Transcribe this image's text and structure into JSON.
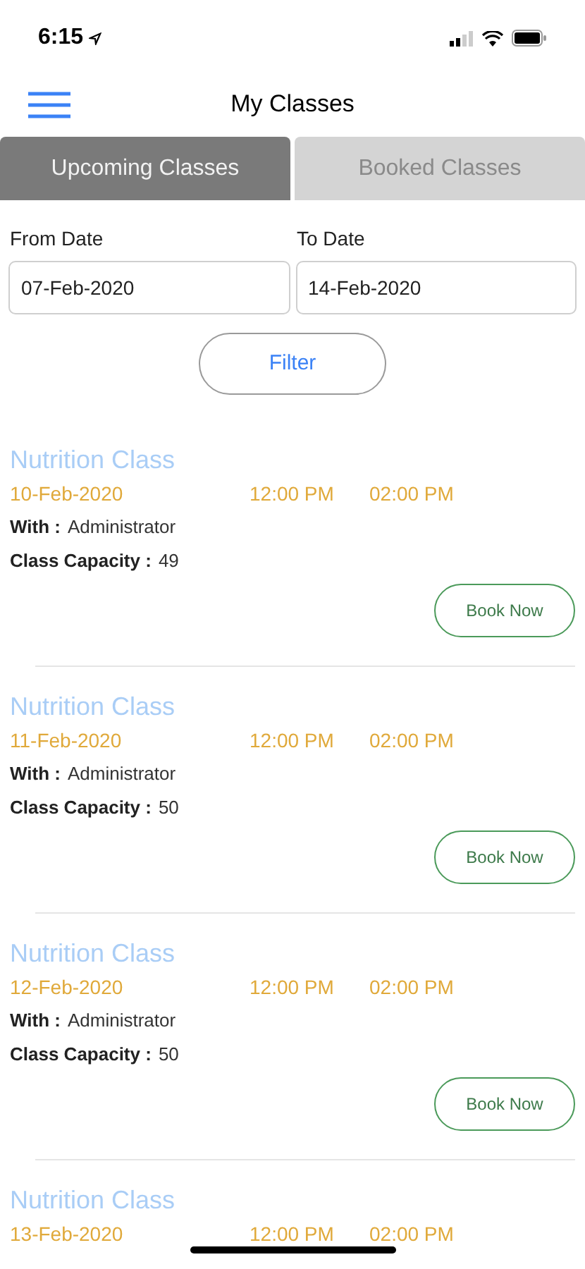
{
  "status_bar": {
    "time": "6:15"
  },
  "nav": {
    "title": "My Classes"
  },
  "tabs": [
    {
      "label": "Upcoming Classes",
      "selected": true
    },
    {
      "label": "Booked Classes",
      "selected": false
    }
  ],
  "filters": [
    {
      "label": "From Date",
      "value": "07-Feb-2020"
    },
    {
      "label": "To Date",
      "value": "14-Feb-2020"
    }
  ],
  "filter_button": "Filter",
  "classes": [
    {
      "title": "Nutrition Class",
      "date": "10-Feb-2020",
      "start": "12:00 PM",
      "end": "02:00 PM",
      "with_label": "With :",
      "with_value": "Administrator",
      "capacity_label": "Class Capacity :",
      "capacity_value": "49",
      "button": "Book Now"
    },
    {
      "title": "Nutrition Class",
      "date": "11-Feb-2020",
      "start": "12:00 PM",
      "end": "02:00 PM",
      "with_label": "With :",
      "with_value": "Administrator",
      "capacity_label": "Class Capacity :",
      "capacity_value": "50",
      "button": "Book Now"
    },
    {
      "title": "Nutrition Class",
      "date": "12-Feb-2020",
      "start": "12:00 PM",
      "end": "02:00 PM",
      "with_label": "With :",
      "with_value": "Administrator",
      "capacity_label": "Class Capacity :",
      "capacity_value": "50",
      "button": "Book Now"
    },
    {
      "title": "Nutrition Class",
      "date": "13-Feb-2020",
      "start": "12:00 PM",
      "end": "02:00 PM"
    }
  ]
}
